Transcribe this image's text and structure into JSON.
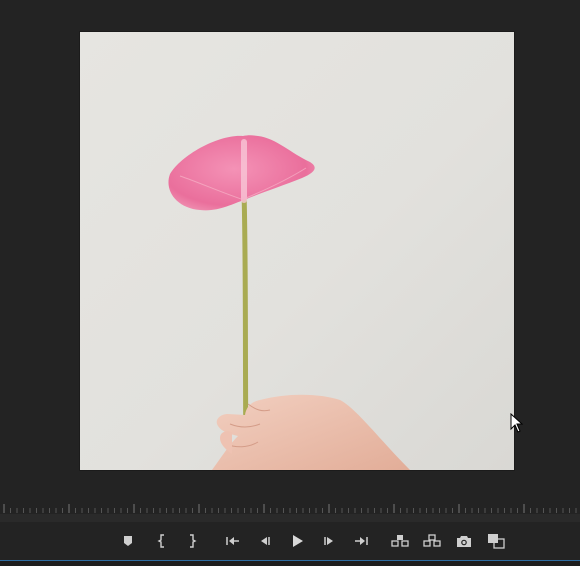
{
  "viewer": {
    "image_subject": "pink-anthurium-flower-in-hand"
  },
  "transport": {
    "buttons": [
      {
        "name": "add-marker-button",
        "icon": "marker-icon"
      },
      {
        "name": "mark-in-button",
        "icon": "mark-in-icon"
      },
      {
        "name": "mark-out-button",
        "icon": "mark-out-icon"
      },
      {
        "name": "go-to-in-button",
        "icon": "go-to-in-icon"
      },
      {
        "name": "step-back-button",
        "icon": "step-back-icon"
      },
      {
        "name": "play-button",
        "icon": "play-icon"
      },
      {
        "name": "step-forward-button",
        "icon": "step-forward-icon"
      },
      {
        "name": "go-to-out-button",
        "icon": "go-to-out-icon"
      },
      {
        "name": "lift-button",
        "icon": "lift-icon"
      },
      {
        "name": "extract-button",
        "icon": "extract-icon"
      },
      {
        "name": "export-frame-button",
        "icon": "camera-icon"
      },
      {
        "name": "comparison-view-button",
        "icon": "comparison-icon"
      }
    ]
  },
  "colors": {
    "background": "#232323",
    "icon": "#cfcfcf",
    "accent": "#2f6ea3",
    "petal": "#ee7fa6",
    "stem": "#a9ab52"
  }
}
